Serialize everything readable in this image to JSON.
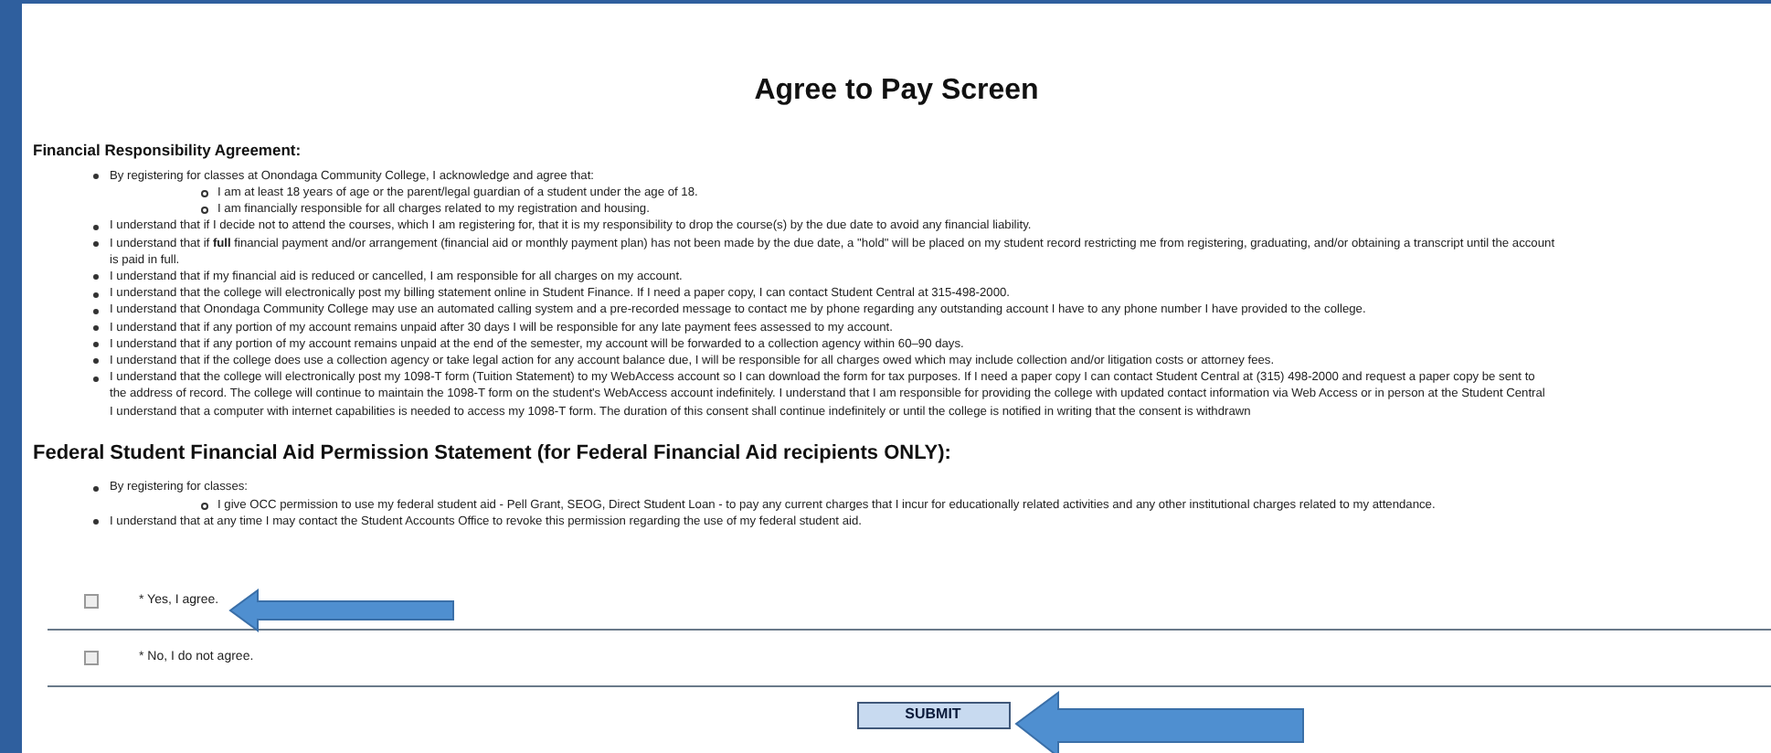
{
  "title": "Agree to Pay Screen",
  "sections": [
    {
      "heading": "Financial Responsibility Agreement:",
      "items": [
        {
          "lines": [
            "By registering for classes at Onondaga Community College, I acknowledge and agree that:"
          ],
          "children": [
            {
              "lines": [
                "I am at least 18 years of age or the parent/legal guardian of a student under the age of 18."
              ]
            },
            {
              "lines": [
                "I am financially responsible for all charges related to my registration and housing."
              ]
            }
          ]
        },
        {
          "lines": [
            "I understand that if I decide not to attend the courses, which I am registering for, that it is my responsibility to drop the course(s) by the due date to avoid any financial liability."
          ]
        },
        {
          "lines": [
            "I understand that if **full** financial payment and/or arrangement (financial aid or monthly payment plan) has not been made by the due date, a \"hold\" will be placed on my student record restricting me from registering, graduating, and/or obtaining a transcript until the account",
            "is paid in full."
          ]
        },
        {
          "lines": [
            "I understand that if my financial aid is reduced or cancelled, I am responsible for all charges on my account."
          ]
        },
        {
          "lines": [
            "I understand that the college will electronically post my billing statement online in Student Finance. If I need a paper copy, I can contact Student Central at 315-498-2000."
          ]
        },
        {
          "lines": [
            "I understand that Onondaga Community College may use an automated calling system and a pre-recorded message to contact me by phone regarding any outstanding account I have to any phone number I have provided to the college."
          ]
        },
        {
          "lines": [
            "I understand that if any portion of my account remains unpaid after 30 days I will be responsible for any late payment fees assessed to my account."
          ]
        },
        {
          "lines": [
            "I understand that if any portion of my account remains unpaid at the end of the semester, my account will be forwarded to a collection agency within 60–90 days."
          ]
        },
        {
          "lines": [
            "I understand that if the college does use a collection agency or take legal action for any account balance due, I will be responsible for all charges owed which may include collection and/or litigation costs or attorney fees."
          ]
        },
        {
          "lines": [
            "I understand that the college will electronically post my 1098-T form (Tuition Statement) to my WebAccess account so I can download the form for tax purposes. If I need a paper copy I can contact Student Central at (315) 498-2000 and request a paper copy be sent to",
            "the address of record. The college will continue to maintain the 1098-T form on the student's WebAccess account indefinitely. I understand that I am responsible for providing the college with updated contact information via Web Access or in person at the Student Central",
            "I understand that a computer with internet capabilities is needed to access my 1098-T form. The duration of this consent shall continue indefinitely or until the college is notified in writing that the consent is withdrawn"
          ]
        }
      ]
    },
    {
      "heading": "Federal Student Financial Aid Permission Statement (for Federal Financial Aid recipients ONLY):",
      "items": [
        {
          "lines": [
            "By registering for classes:"
          ],
          "children": [
            {
              "lines": [
                "I give OCC permission to use my federal student aid - Pell Grant, SEOG, Direct Student Loan - to pay any current charges that I incur for educationally related activities and any other institutional charges related to my attendance."
              ]
            }
          ]
        },
        {
          "lines": [
            "I understand that at any time I may contact the Student Accounts Office to revoke this permission regarding the use of my federal student aid."
          ]
        }
      ]
    }
  ],
  "options": [
    {
      "label": "* Yes, I agree.",
      "checked": false
    },
    {
      "label": "* No, I do not agree.",
      "checked": false
    }
  ],
  "submit": "SUBMIT"
}
